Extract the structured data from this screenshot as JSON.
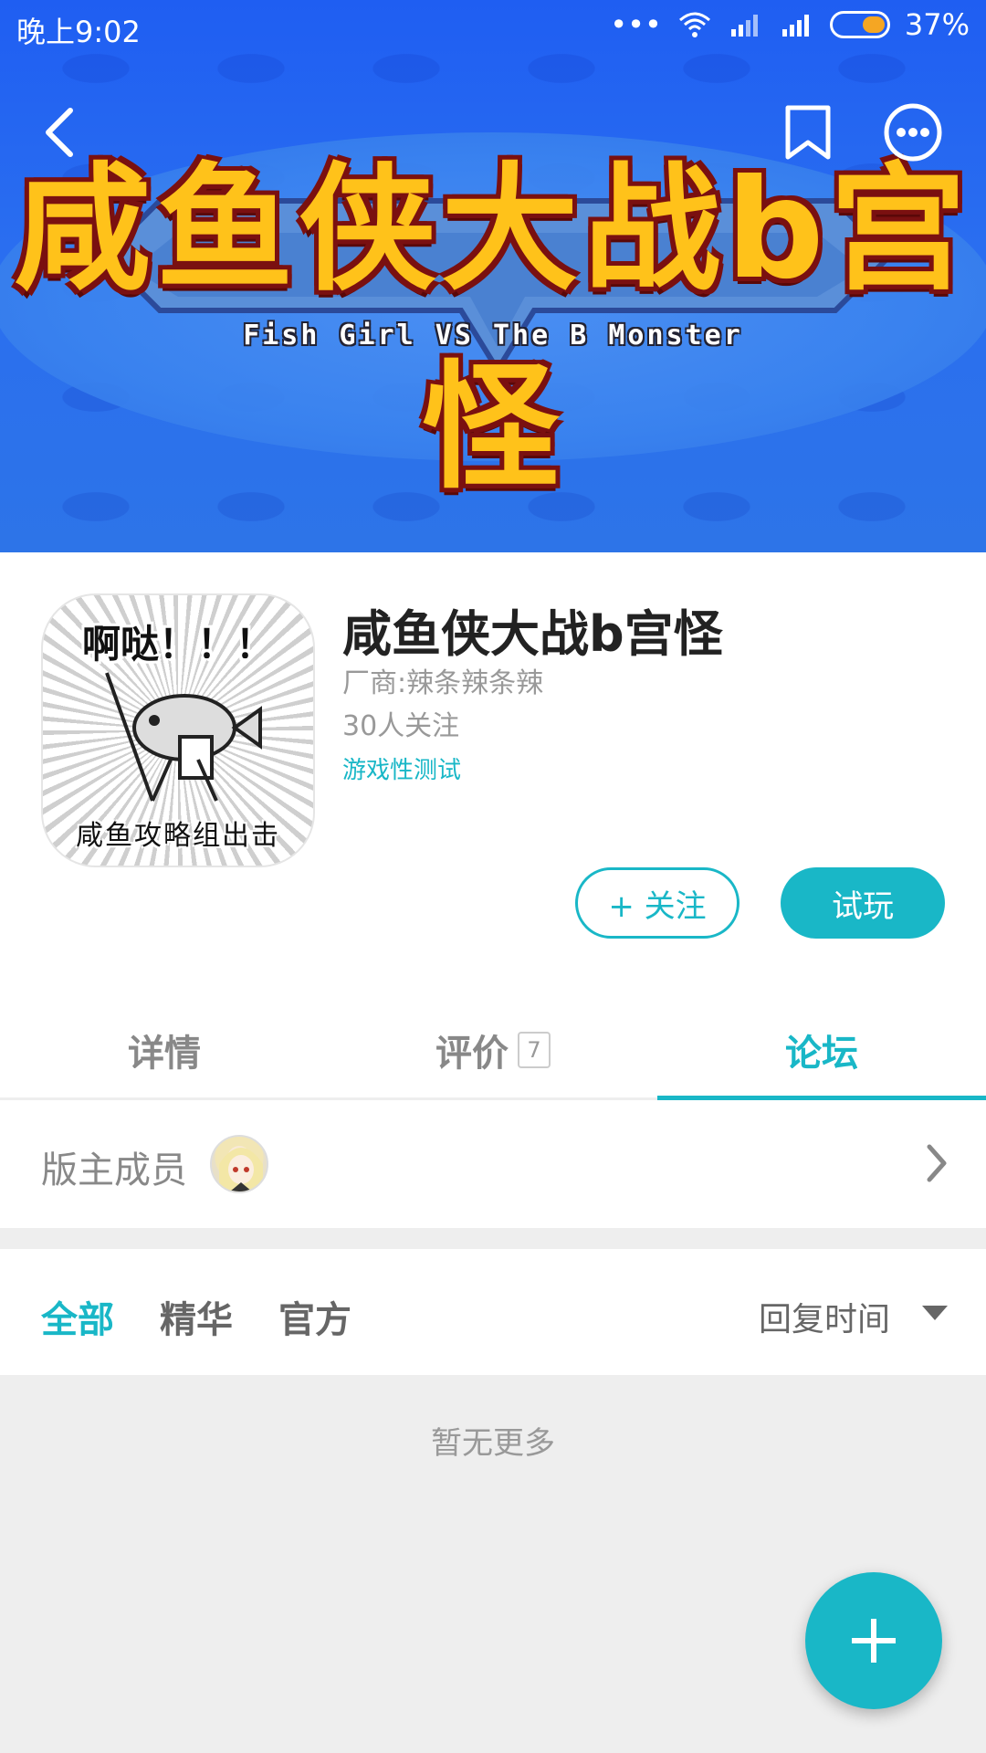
{
  "status_bar": {
    "time": "晚上9:02",
    "battery": "37%"
  },
  "banner": {
    "title": "咸鱼侠大战b宫怪",
    "subtitle": "Fish Girl VS The B Monster"
  },
  "header_icons": [
    "back-arrow-icon",
    "bookmark-icon",
    "more-icon"
  ],
  "app": {
    "icon_text_top": "啊哒！！！",
    "icon_text_bottom": "咸鱼攻略组出击",
    "title": "咸鱼侠大战b宫怪",
    "vendor": "厂商:辣条辣条辣",
    "followers": "30人关注",
    "tag": "游戏性测试",
    "follow_label": "+ 关注",
    "play_label": "试玩"
  },
  "tabs": [
    {
      "label": "详情"
    },
    {
      "label": "评价",
      "count": "7"
    },
    {
      "label": "论坛",
      "active": true
    }
  ],
  "moderators": {
    "label": "版主成员"
  },
  "filters": {
    "items": [
      "全部",
      "精华",
      "官方"
    ],
    "active": "全部",
    "sort_label": "回复时间"
  },
  "empty_text": "暂无更多",
  "colors": {
    "accent": "#19b7c7",
    "banner_blue": "#2a6ef0",
    "title_gold": "#ffc21a"
  }
}
